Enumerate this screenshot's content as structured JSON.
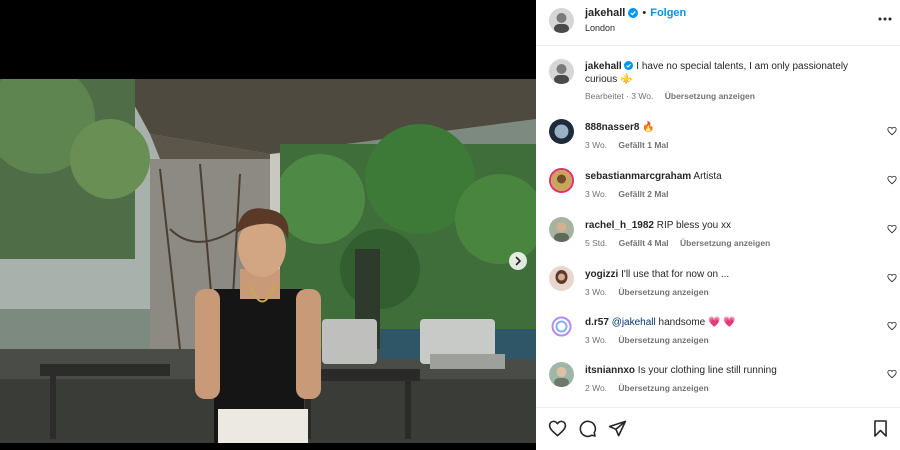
{
  "post": {
    "username": "jakehall",
    "follow_label": "Folgen",
    "location": "London",
    "caption_user": "jakehall",
    "caption_text": "I have no special talents, I am only passionately curious ⚜️",
    "caption_time": "Bearbeitet · 3 Wo.",
    "caption_translate": "Übersetzung anzeigen"
  },
  "comments": [
    {
      "user": "888nasser8",
      "text": "🔥",
      "time": "3 Wo.",
      "likes": "Gefällt 1 Mal",
      "translate": ""
    },
    {
      "user": "sebastianmarcgraham",
      "text": "Artista",
      "time": "3 Wo.",
      "likes": "Gefällt 2 Mal",
      "translate": ""
    },
    {
      "user": "rachel_h_1982",
      "text": "RIP bless you xx",
      "time": "5 Std.",
      "likes": "Gefällt 4 Mal",
      "translate": "Übersetzung anzeigen"
    },
    {
      "user": "yogizzi",
      "text": "I'll use that for now on ...",
      "time": "3 Wo.",
      "likes": "",
      "translate": "Übersetzung anzeigen"
    },
    {
      "user": "d.r57",
      "mention": "@jakehall",
      "text": " handsome 💗 💗",
      "time": "3 Wo.",
      "likes": "",
      "translate": "Übersetzung anzeigen"
    },
    {
      "user": "itsniannxo",
      "text": "Is your clothing line still running",
      "time": "2 Wo.",
      "likes": "",
      "translate": "Übersetzung anzeigen"
    }
  ],
  "colors": {
    "accent": "#0095f6",
    "verified": "#0095f6",
    "muted": "#737373"
  },
  "icons": {
    "like": "heart-icon",
    "comment": "comment-icon",
    "share": "share-icon",
    "save": "bookmark-icon",
    "more": "more-options-icon",
    "next": "chevron-right-icon"
  }
}
